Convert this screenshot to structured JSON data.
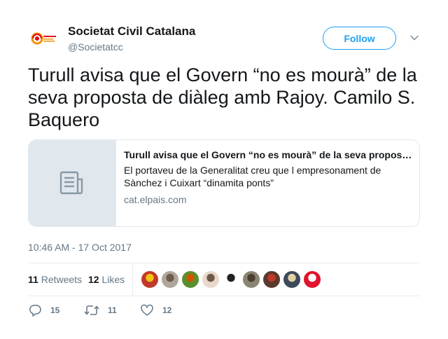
{
  "user": {
    "display_name": "Societat Civil Catalana",
    "screen_name": "@Societatcc",
    "avatar_icon": "societat-civil-catalana-logo"
  },
  "follow_label": "Follow",
  "tweet": {
    "text": "Turull avisa que el Govern “no es mourà” de la seva proposta de diàleg amb Rajoy. Camilo S. Baquero"
  },
  "card": {
    "title": "Turull avisa que el Govern “no es mourà” de la seva proposta de diàleg amb Rajoy",
    "description": "El portaveu de la Generalitat creu que l empresonament de Sànchez i Cuixart “dinamita ponts”",
    "domain": "cat.elpais.com",
    "thumb_icon": "document-icon"
  },
  "timestamp": "10:46 AM - 17 Oct 2017",
  "stats": {
    "retweets_count": "11",
    "retweets_label": "Retweets",
    "likes_count": "12",
    "likes_label": "Likes"
  },
  "likers": [
    {
      "color": "#c0392b",
      "accent": "#f1c40f"
    },
    {
      "color": "#b0a79c",
      "accent": "#6d5d4b"
    },
    {
      "color": "#5a8f2d",
      "accent": "#d35400"
    },
    {
      "color": "#e8d8cc",
      "accent": "#6b5a4a"
    },
    {
      "color": "#ffffff",
      "accent": "#222222"
    },
    {
      "color": "#8a8472",
      "accent": "#4a3f30"
    },
    {
      "color": "#5b3a2e",
      "accent": "#c0392b"
    },
    {
      "color": "#3d4a5c",
      "accent": "#e3d3a4"
    },
    {
      "color": "#e0142d",
      "accent": "#ffffff"
    }
  ],
  "actions": {
    "replies": "15",
    "retweets": "11",
    "likes": "12"
  },
  "colors": {
    "accent": "#1da1f2",
    "secondary_text": "#657786",
    "border": "#e6ecf0"
  }
}
